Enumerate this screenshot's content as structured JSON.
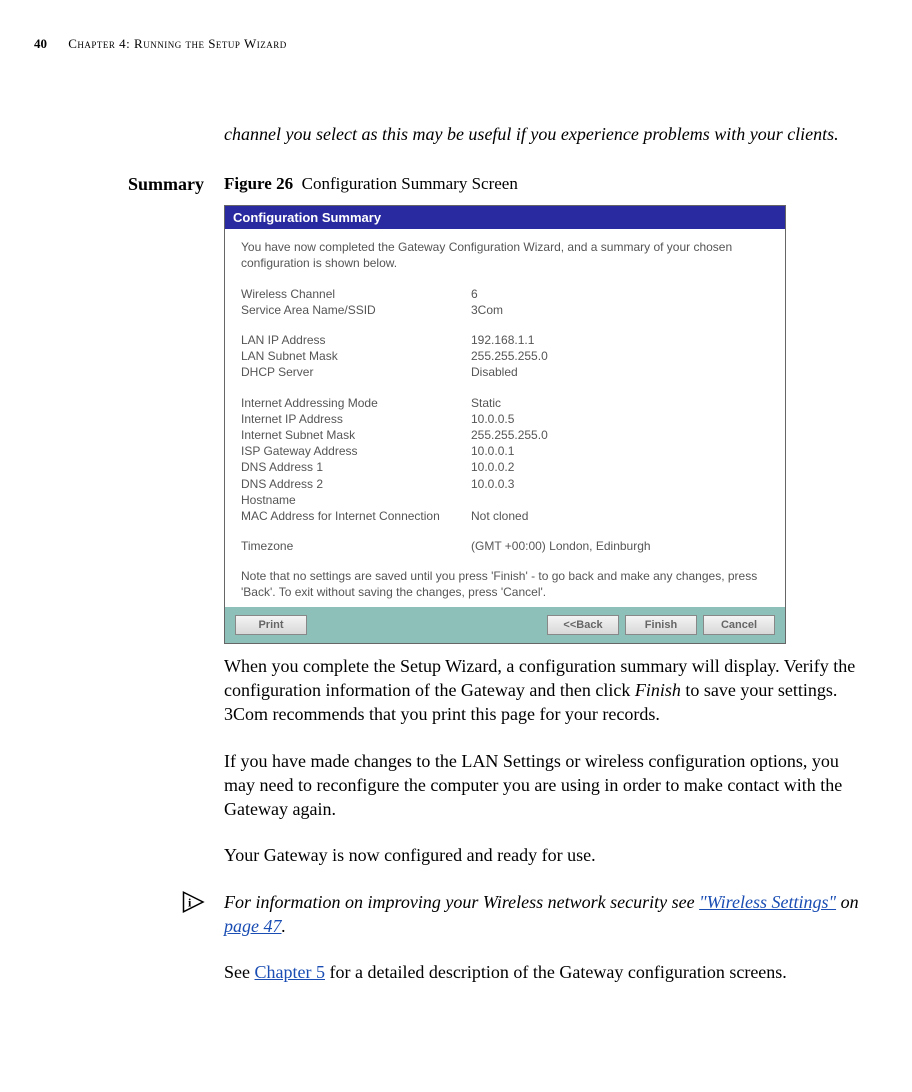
{
  "header": {
    "page_number": "40",
    "chapter": "Chapter 4: Running the Setup Wizard"
  },
  "intro": "channel you select as this may be useful if you experience problems with your clients.",
  "section_label": "Summary",
  "figure": {
    "label": "Figure 26",
    "caption": "Configuration Summary Screen"
  },
  "screenshot": {
    "title": "Configuration Summary",
    "intro": "You have now completed the Gateway Configuration Wizard, and a summary of your chosen configuration is shown below.",
    "rows": [
      {
        "label": "Wireless Channel",
        "value": "6"
      },
      {
        "label": "Service Area Name/SSID",
        "value": "3Com"
      }
    ],
    "rows2": [
      {
        "label": "LAN IP Address",
        "value": "192.168.1.1"
      },
      {
        "label": "LAN Subnet Mask",
        "value": "255.255.255.0"
      },
      {
        "label": "DHCP Server",
        "value": "Disabled"
      }
    ],
    "rows3": [
      {
        "label": "Internet Addressing Mode",
        "value": "Static"
      },
      {
        "label": "Internet IP Address",
        "value": "10.0.0.5"
      },
      {
        "label": "Internet Subnet Mask",
        "value": "255.255.255.0"
      },
      {
        "label": "ISP Gateway Address",
        "value": "10.0.0.1"
      },
      {
        "label": "DNS Address 1",
        "value": "10.0.0.2"
      },
      {
        "label": "DNS Address 2",
        "value": "10.0.0.3"
      },
      {
        "label": "Hostname",
        "value": ""
      },
      {
        "label": "MAC Address for Internet Connection",
        "value": "Not cloned"
      }
    ],
    "rows4": [
      {
        "label": "Timezone",
        "value": "(GMT +00:00) London, Edinburgh"
      }
    ],
    "note": "Note that no settings are saved until you press 'Finish' - to go back and make any changes, press 'Back'. To exit without saving the changes, press 'Cancel'.",
    "buttons": {
      "print": "Print",
      "back": "<<Back",
      "finish": "Finish",
      "cancel": "Cancel"
    }
  },
  "body": {
    "p1a": "When you complete the Setup Wizard, a configuration summary will display. Verify the configuration information of the Gateway and then click ",
    "p1_finish": "Finish",
    "p1b": " to save your settings. 3Com recommends that you print this page for your records.",
    "p2": "If you have made changes to the LAN Settings or wireless configuration options, you may need to reconfigure the computer you are using in order to make contact with the Gateway again.",
    "p3": "Your Gateway is now configured and ready for use.",
    "info_a": "For information on improving your Wireless network security see ",
    "info_link": "\"Wireless Settings\"",
    "info_b": " on ",
    "info_page": "page 47",
    "info_c": ".",
    "p4a": "See ",
    "p4_link": "Chapter 5",
    "p4b": " for a detailed description of the Gateway configuration screens."
  }
}
